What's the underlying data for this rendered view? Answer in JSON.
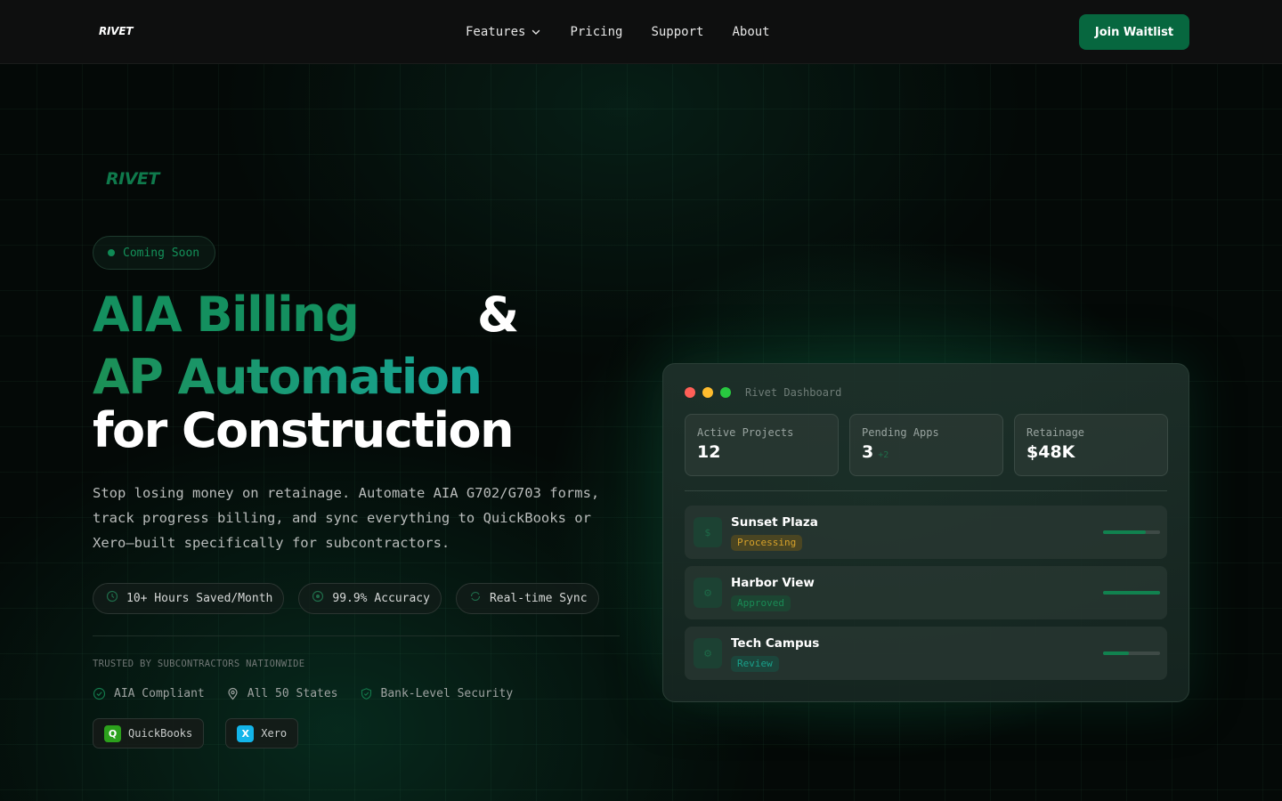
{
  "nav": {
    "logo": "RIVET",
    "links": [
      {
        "label": "Features",
        "has_dropdown": true
      },
      {
        "label": "Pricing"
      },
      {
        "label": "Support"
      },
      {
        "label": "About"
      }
    ],
    "cta_label": "Join Waitlist"
  },
  "hero": {
    "brand_mark": "RIVET",
    "badge": "Coming Soon",
    "headline_line1": "AIA Billing",
    "headline_amp": "&",
    "headline_line2": "AP Automation",
    "headline_line3": "for Construction",
    "subtitle": "Stop losing money on retainage. Automate AIA G702/G703 forms, track progress billing, and sync everything to QuickBooks or Xero—built specifically for subcontractors.",
    "stats": [
      {
        "icon": "clock-icon",
        "label": "10+ Hours Saved/Month"
      },
      {
        "icon": "target-icon",
        "label": "99.9% Accuracy"
      },
      {
        "icon": "sync-icon",
        "label": "Real-time Sync"
      }
    ],
    "trusted_label": "TRUSTED BY SUBCONTRACTORS NATIONWIDE",
    "checks": [
      {
        "icon": "check-circle-icon",
        "label": "AIA Compliant"
      },
      {
        "icon": "map-pin-icon",
        "label": "All 50 States"
      },
      {
        "icon": "shield-check-icon",
        "label": "Bank-Level Security"
      }
    ],
    "integrations": [
      {
        "logo_letter": "Q",
        "label": "QuickBooks",
        "color": "#2ca01c"
      },
      {
        "logo_letter": "X",
        "label": "Xero",
        "color": "#13b5ea"
      }
    ]
  },
  "dashboard": {
    "title": "Rivet Dashboard",
    "window_dots": [
      "#ff5f57",
      "#febc2e",
      "#28c840"
    ],
    "cards": [
      {
        "label": "Active Projects",
        "value": "12",
        "delta": ""
      },
      {
        "label": "Pending Apps",
        "value": "3",
        "delta": "+2"
      },
      {
        "label": "Retainage",
        "value": "$48K",
        "delta": ""
      }
    ],
    "projects": [
      {
        "icon_glyph": "$",
        "name": "Sunset Plaza",
        "status": "Processing",
        "status_class": "st-processing",
        "progress": 0.75
      },
      {
        "icon_glyph": "⚙",
        "name": "Harbor View",
        "status": "Approved",
        "status_class": "st-approved",
        "progress": 1.0
      },
      {
        "icon_glyph": "⚙",
        "name": "Tech Campus",
        "status": "Review",
        "status_class": "st-review",
        "progress": 0.45
      }
    ]
  },
  "colors": {
    "accent": "#07673f",
    "headline_green": "#14905f",
    "teal": "#17a597"
  }
}
